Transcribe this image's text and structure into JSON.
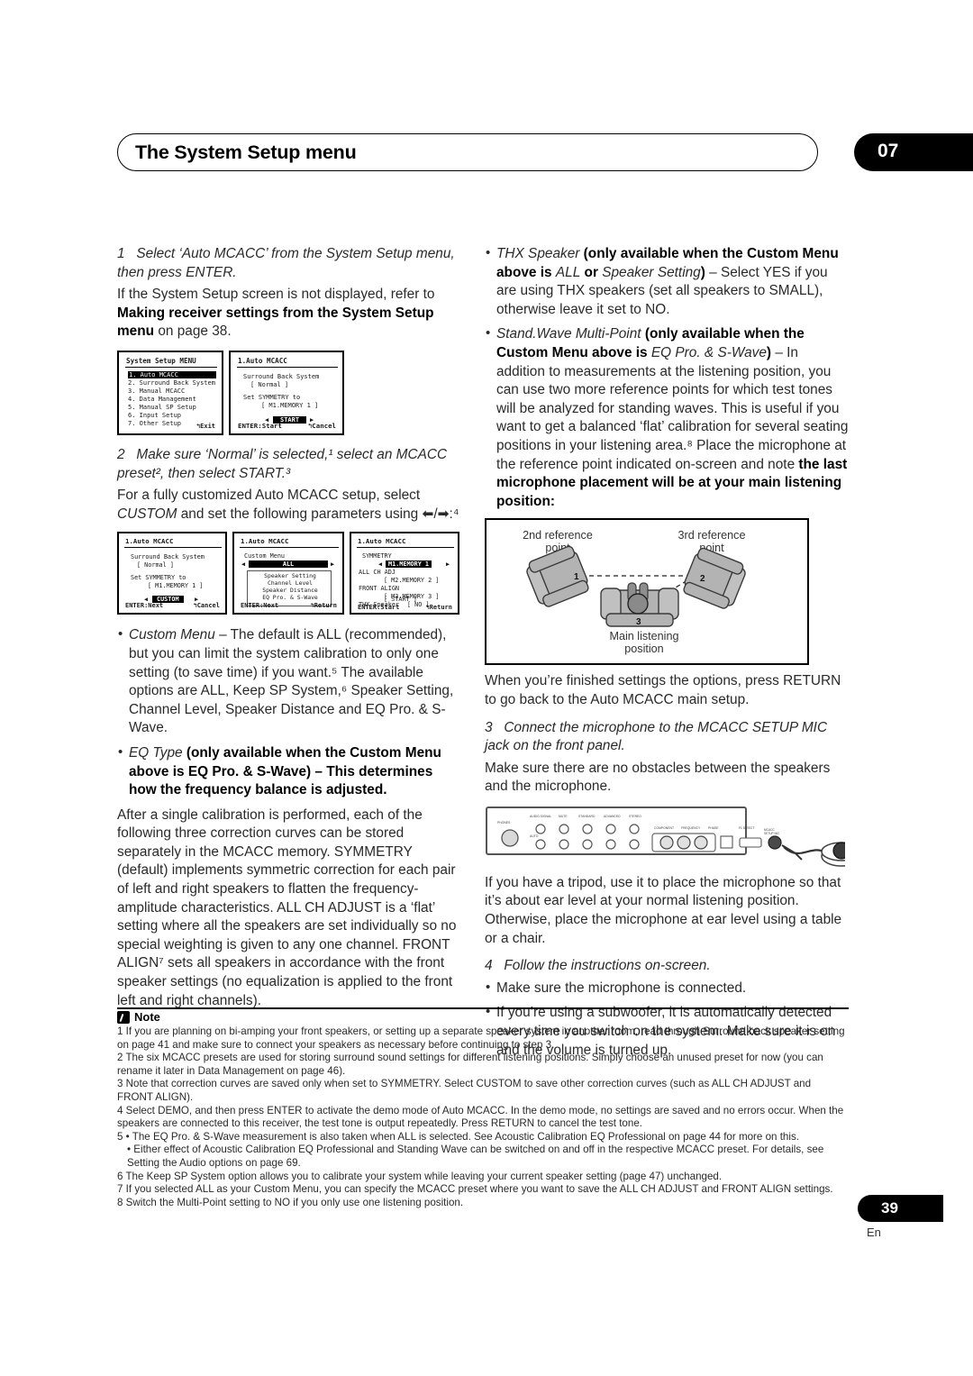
{
  "header": {
    "title": "The System Setup menu",
    "chapter": "07"
  },
  "left_column": {
    "step1": {
      "num": "1",
      "italic_title": "Select ‘Auto MCACC’ from the System Setup menu, then press ENTER.",
      "body_pre": "If the System Setup screen is not displayed, refer to ",
      "body_bold": "Making receiver settings from the System Setup menu",
      "body_post": " on page 38."
    },
    "osd_pair": [
      {
        "title": "System Setup MENU",
        "items": [
          "1. Auto MCACC",
          "2. Surround Back System",
          "3. Manual MCACC",
          "4. Data Management",
          "5. Manual SP Setup",
          "6. Input Setup",
          "7. Other Setup"
        ],
        "selected_index": 0,
        "footer_right": "↰Exit"
      },
      {
        "title": "1.Auto MCACC",
        "line1": "Surround Back System",
        "value1": "[    Normal    ]",
        "line2": "Set SYMMETRY to",
        "value2": "[ M1.MEMORY 1 ]",
        "button": "START",
        "footer_left": "ENTER:Start",
        "footer_right": "↰Cancel"
      }
    ],
    "step2": {
      "num": "2",
      "italic_title": "Make sure ‘Normal’ is selected,¹ select an MCACC preset², then select START.³",
      "body_pre": "For a fully customized Auto MCACC setup, select ",
      "body_italic": "CUSTOM",
      "body_post": " and set the following parameters using ⬅︎/➡︎:⁴"
    },
    "osd_trio": [
      {
        "title": "1.Auto MCACC",
        "line1": "Surround Back System",
        "value1": "[    Normal    ]",
        "line2": "Set SYMMETRY to",
        "value2": "[ M1.MEMORY 1 ]",
        "button": "CUSTOM",
        "footer_left": "ENTER:Next",
        "footer_right": "↰Cancel"
      },
      {
        "title": "1.Auto MCACC",
        "line1": "Custom Menu",
        "value1": "ALL",
        "box_items": [
          "Speaker Setting",
          "Channel Level",
          "Speaker Distance",
          "EQ Pro. & S-Wave"
        ],
        "footer_left": "ENTER:Next",
        "footer_right": "↰Return"
      },
      {
        "title": "1.Auto MCACC",
        "rows": [
          {
            "label": "SYMMETRY",
            "value": "M1.MEMORY 1",
            "highlight": true
          },
          {
            "label": "ALL CH ADJ",
            "value": "[ M2.MEMORY 2 ]",
            "highlight": false
          },
          {
            "label": "FRONT ALIGN",
            "value": "[ M3.MEMORY 3 ]",
            "highlight": false
          },
          {
            "label": "THX Speaker",
            "value": "[  NO  ]",
            "highlight": false
          }
        ],
        "button": "[  START  ]",
        "footer_left": "ENTER:Start",
        "footer_right": "↰Return"
      }
    ],
    "bullets": [
      {
        "id": "custom-menu",
        "lead_italic": "Custom Menu",
        "text": " – The default is ALL (recommended), but you can limit the system calibration to only one setting (to save time) if you want.⁵ The available options are ALL, Keep SP System,⁶ Speaker Setting, Channel Level, Speaker Distance and EQ Pro. & S-Wave."
      },
      {
        "id": "eq-type",
        "lead_italic": "EQ Type",
        "text": " (only available when the Custom Menu above is EQ Pro. & S-Wave) – This determines how the frequency balance is adjusted."
      }
    ],
    "paragraph": "After a single calibration is performed, each of the following three correction curves can be stored separately in the MCACC memory. SYMMETRY (default) implements symmetric correction for each pair of left and right speakers to flatten the frequency-amplitude characteristics. ALL CH ADJUST is a ‘flat’ setting where all the speakers are set individually so no special weighting is given to any one channel. FRONT ALIGN⁷ sets all speakers in accordance with the front speaker settings (no equalization is applied to the front left and right channels)."
  },
  "right_column": {
    "bullets": [
      {
        "id": "thx-speaker",
        "lead_italic": "THX Speaker",
        "bold1": " (only available when the Custom Menu above is ",
        "ital1": "ALL",
        "bold2": " or ",
        "ital2": "Speaker Setting",
        "bold3": ")",
        "rest": " – Select YES if you are using THX speakers (set all speakers to SMALL), otherwise leave it set to NO."
      },
      {
        "id": "stand-wave-multi-point",
        "lead_italic": "Stand.Wave Multi-Point",
        "bold1": " (only available when the Custom Menu above is ",
        "ital1": "EQ Pro. & S-Wave",
        "bold3": ")",
        "rest": " – In addition to measurements at the listening position, you can use two more reference points for which test tones will be analyzed for standing waves. This is useful if you want to get a balanced ‘flat’ calibration for several seating positions in your listening area.⁸ Place the microphone at the reference point indicated on-screen and note ",
        "rest_bold": "the last microphone placement will be at your main listening position:"
      }
    ],
    "room_diagram": {
      "label_2nd": "2nd reference\npoint",
      "label_3rd": "3rd reference\npoint",
      "label_main": "Main listening\nposition",
      "chair1": "1",
      "chair2": "2",
      "sofa": "3"
    },
    "after_diagram": "When you’re finished settings the options, press RETURN to go back to the Auto MCACC main setup.",
    "step3": {
      "num": "3",
      "italic_title": "Connect the microphone to the MCACC SETUP MIC jack on the front panel.",
      "body": "Make sure there are no obstacles between the speakers and the microphone."
    },
    "panel_diagram": {
      "left_knob_label": "PHONES",
      "jack_label": "MCACC SETUP MIC"
    },
    "after_panel": "If you have a tripod, use it to place the microphone so that it’s about ear level at your normal listening position. Otherwise, place the microphone at ear level using a table or a chair.",
    "step4": {
      "num": "4",
      "italic_title": "Follow the instructions on-screen.",
      "bullets": [
        "Make sure the microphone is connected.",
        "If you’re using a subwoofer, it is automatically detected every time you switch on the system. Make sure it is on and the volume is turned up."
      ]
    }
  },
  "notes": {
    "heading": "Note",
    "items": [
      "1 If you are planning on bi-amping your front speakers, or setting up a separate speaker system in another room, read through Surround back speaker setting on page 41 and make sure to connect your speakers as necessary before continuing to step 3.",
      "2 The six MCACC presets are used for storing surround sound settings for different listening positions. Simply choose an unused preset for now (you can rename it later in Data Management on page 46).",
      "3 Note that correction curves are saved only when set to SYMMETRY. Select CUSTOM to save other correction curves (such as ALL CH ADJUST and FRONT ALIGN).",
      "4 Select DEMO, and then press ENTER to activate the demo mode of Auto MCACC. In the demo mode, no settings are saved and no errors occur. When the speakers are connected to this receiver, the test tone is output repeatedly. Press RETURN to cancel the test tone.",
      "5 • The EQ Pro. & S-Wave measurement is also taken when ALL is selected. See Acoustic Calibration EQ Professional on page 44 for more on this.",
      "• Either effect of Acoustic Calibration EQ Professional and Standing Wave can be switched on and off in the respective MCACC preset. For details, see Setting the Audio options on page 69.",
      "6 The Keep SP System option allows you to calibrate your system while leaving your current speaker setting (page 47) unchanged.",
      "7 If you selected ALL as your Custom Menu, you can specify the MCACC preset where you want to save the ALL CH ADJUST and FRONT ALIGN settings.",
      "8 Switch the Multi-Point setting to NO if you only use one listening position."
    ]
  },
  "footer": {
    "page_number": "39",
    "language": "En"
  },
  "colors": {
    "ink": "#1a1a1a",
    "body": "#2a2a2a",
    "accent": "#000000",
    "chair_fill": "#b3b3b3",
    "chair_stroke": "#3a3a3a"
  }
}
